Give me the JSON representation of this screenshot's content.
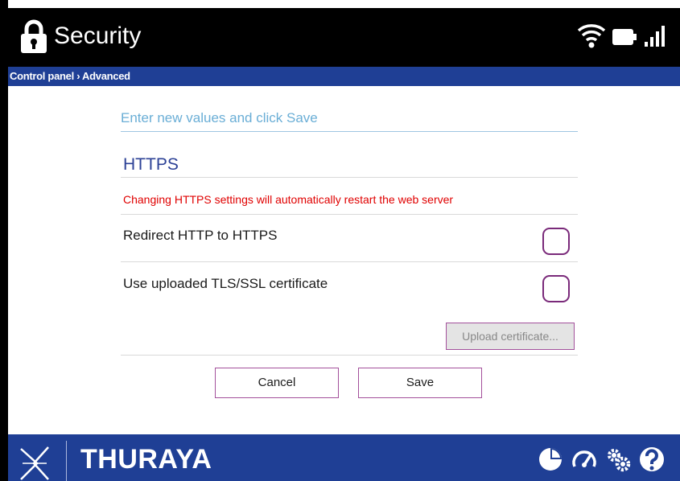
{
  "header": {
    "title": "Security",
    "icons": [
      "lock-icon",
      "wifi-icon",
      "battery-icon",
      "signal-icon"
    ]
  },
  "breadcrumb": "Control panel › Advanced",
  "form": {
    "instruction": "Enter new values and click Save",
    "section_title": "HTTPS",
    "warning": "Changing HTTPS settings will automatically restart the web server",
    "options": [
      {
        "label": "Redirect HTTP to HTTPS",
        "checked": false
      },
      {
        "label": "Use uploaded TLS/SSL certificate",
        "checked": false
      }
    ],
    "upload_label": "Upload certificate...",
    "cancel_label": "Cancel",
    "save_label": "Save"
  },
  "footer": {
    "brand": "THURAYA",
    "icons": [
      "dashboard-icon",
      "speedometer-icon",
      "settings-icon",
      "help-icon"
    ]
  },
  "colors": {
    "header_bg": "#000000",
    "bar_bg": "#1f3f95",
    "accent_purple": "#7a2a7a",
    "warning_red": "#e00000",
    "instruction_blue": "#6aaed6"
  }
}
